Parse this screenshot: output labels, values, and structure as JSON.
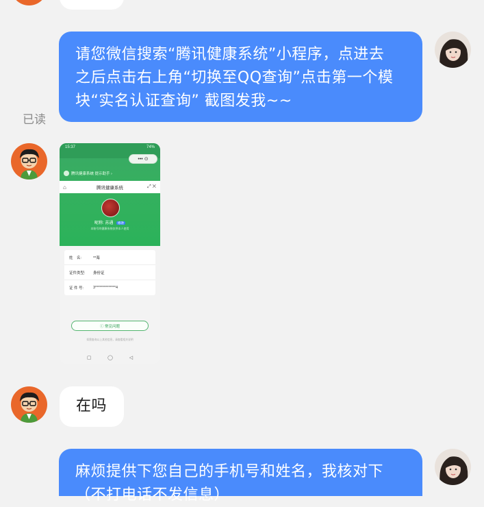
{
  "messages": [
    {
      "id": "msg-top-partial",
      "side": "other",
      "text": ""
    },
    {
      "id": "msg-1",
      "side": "self",
      "lines": [
        "请您微信搜索“腾讯健康系统”小程序，点进去",
        "之后点击右上角“切换至QQ查询”点击第一个模",
        "块“实名认证查询” 截图发我~~"
      ],
      "status": "已读"
    },
    {
      "id": "msg-2",
      "side": "other",
      "type": "image",
      "screenshot": {
        "status_time": "15:37",
        "status_right": "74%",
        "capsule": "•••  ⊙",
        "tip": "腾讯健康系统 提示助手 ›",
        "title": "腾讯健康系统",
        "nickname_label": "昵称:",
        "nickname_value": "苏通",
        "nickname_badge": "修改",
        "subtitle": "本账号的健康系统仅供本人使用",
        "fields": [
          {
            "label": "姓　名:",
            "value": "**海"
          },
          {
            "label": "证件类型:",
            "value": "身份证"
          },
          {
            "label": "证 件 号:",
            "value": "3**************4"
          }
        ],
        "faq_button": "常见问题",
        "footer": "如需查询以上其他信息，请查看相关说明",
        "nav": [
          "▢",
          "◯",
          "◁"
        ]
      }
    },
    {
      "id": "msg-3",
      "side": "other",
      "text": "在吗"
    },
    {
      "id": "msg-4",
      "side": "self",
      "lines": [
        "麻烦提供下您自己的手机号和姓名，我核对下",
        "（不打电话不发信息）"
      ]
    }
  ]
}
